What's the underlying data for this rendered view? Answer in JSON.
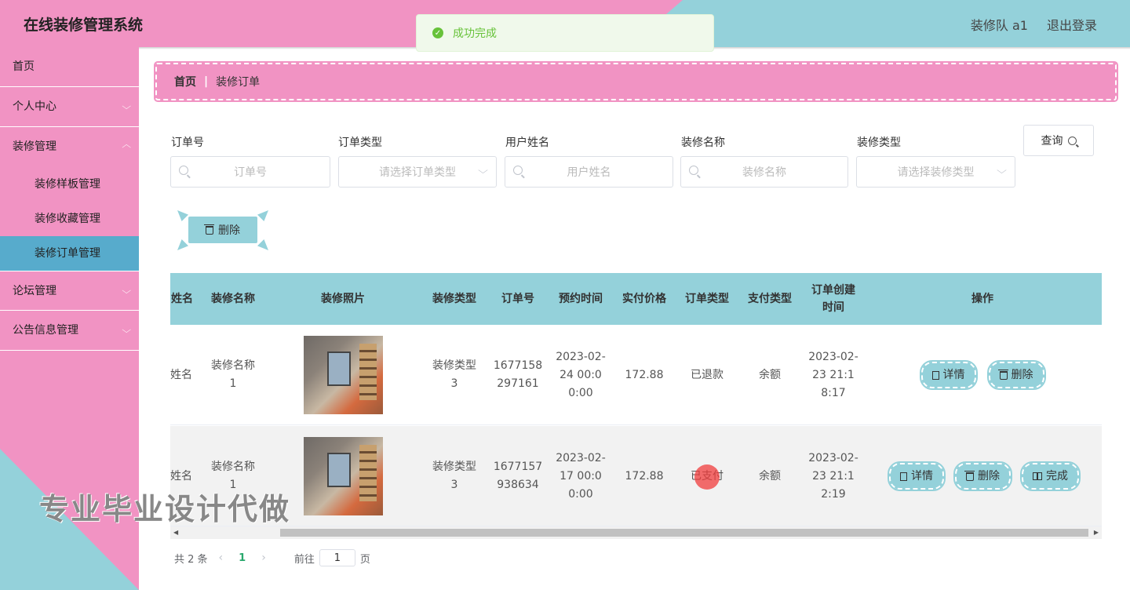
{
  "header": {
    "title": "在线装修管理系统",
    "user": "装修队 a1",
    "logout": "退出登录"
  },
  "toast": {
    "text": "成功完成"
  },
  "sidebar": {
    "items": [
      {
        "label": "首页"
      },
      {
        "label": "个人中心"
      },
      {
        "label": "装修管理"
      },
      {
        "label": "装修样板管理"
      },
      {
        "label": "装修收藏管理"
      },
      {
        "label": "装修订单管理"
      },
      {
        "label": "论坛管理"
      },
      {
        "label": "公告信息管理"
      }
    ]
  },
  "breadcrumb": {
    "home": "首页",
    "sep": "|",
    "current": "装修订单"
  },
  "search": {
    "fields": [
      {
        "label": "订单号",
        "placeholder": "订单号"
      },
      {
        "label": "订单类型",
        "placeholder": "请选择订单类型"
      },
      {
        "label": "用户姓名",
        "placeholder": "用户姓名"
      },
      {
        "label": "装修名称",
        "placeholder": "装修名称"
      },
      {
        "label": "装修类型",
        "placeholder": "请选择装修类型"
      }
    ],
    "query_label": "查询"
  },
  "bulk_delete_label": "删除",
  "table": {
    "headers": [
      "姓名",
      "装修名称",
      "装修照片",
      "装修类型",
      "订单号",
      "预约时间",
      "实付价格",
      "订单类型",
      "支付类型",
      "订单创建时间",
      "操作"
    ],
    "rows": [
      {
        "name": "姓名",
        "reno_name": "装修名称 1",
        "reno_type": "装修类型 3",
        "order_no": "1677158297161",
        "appointment": "2023-02-24 00:00:00",
        "price": "172.88",
        "order_type": "已退款",
        "pay_type": "余额",
        "created": "2023-02-23 21:18:17",
        "actions": [
          "详情",
          "删除"
        ]
      },
      {
        "name": "姓名",
        "reno_name": "装修名称 1",
        "reno_type": "装修类型 3",
        "order_no": "1677157938634",
        "appointment": "2023-02-17 00:00:00",
        "price": "172.88",
        "order_type": "已支付",
        "pay_type": "余额",
        "created": "2023-02-23 21:12:19",
        "actions": [
          "详情",
          "删除",
          "完成"
        ]
      }
    ]
  },
  "pagination": {
    "total": "共 2 条",
    "current": "1",
    "goto": "前往",
    "page_value": "1",
    "page_unit": "页"
  },
  "watermark": "专业毕业设计代做",
  "colors": {
    "pink": "#f193c3",
    "teal": "#94d1da",
    "active_blue": "#57abcc",
    "success": "#67c23a"
  }
}
